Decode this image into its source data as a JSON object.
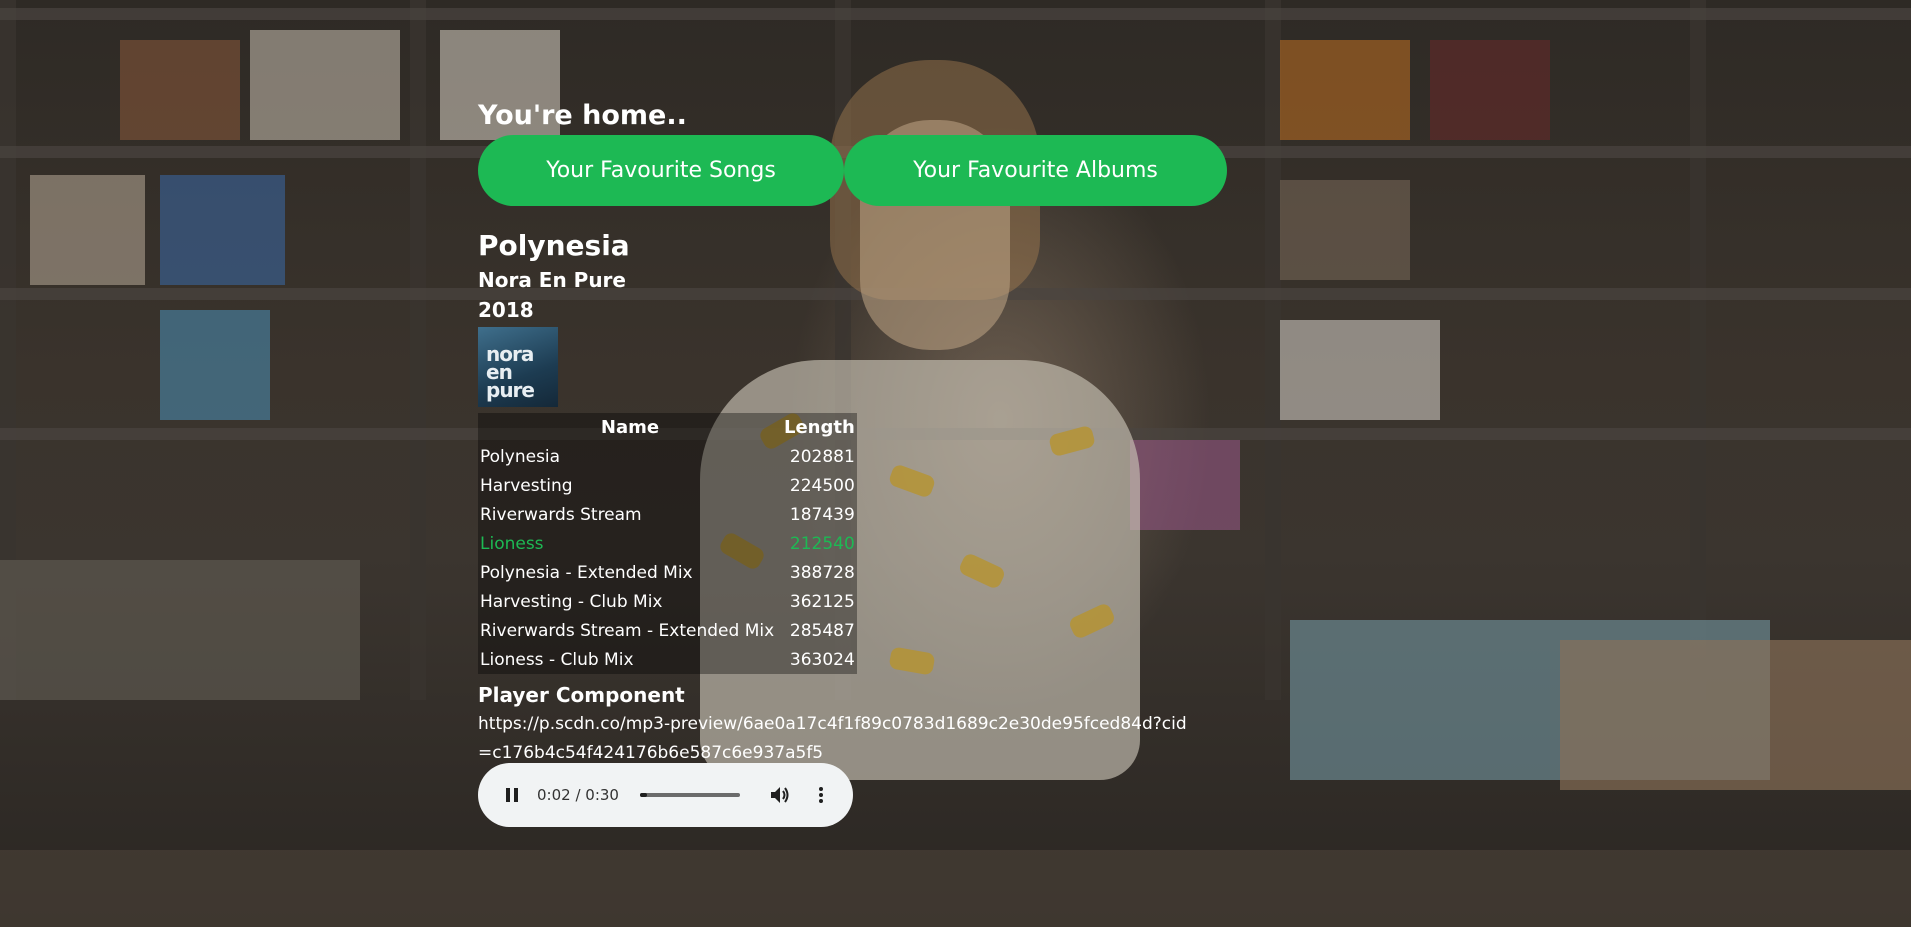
{
  "page": {
    "heading": "You're home.."
  },
  "nav": {
    "songs_label": "Your Favourite Songs",
    "albums_label": "Your Favourite Albums"
  },
  "album": {
    "title": "Polynesia",
    "artist": "Nora En Pure",
    "year": "2018",
    "cover_text": [
      "nora",
      "en",
      "pure"
    ]
  },
  "tracks": {
    "headers": [
      "Name",
      "Length"
    ],
    "rows": [
      {
        "name": "Polynesia",
        "length": "202881"
      },
      {
        "name": "Harvesting",
        "length": "224500"
      },
      {
        "name": "Riverwards Stream",
        "length": "187439"
      },
      {
        "name": "Lioness",
        "length": "212540",
        "active": true
      },
      {
        "name": "Polynesia - Extended Mix",
        "length": "388728"
      },
      {
        "name": "Harvesting - Club Mix",
        "length": "362125"
      },
      {
        "name": "Riverwards Stream - Extended Mix",
        "length": "285487"
      },
      {
        "name": "Lioness - Club Mix",
        "length": "363024"
      }
    ],
    "active_color": "#1db954"
  },
  "player": {
    "heading": "Player Component",
    "url": "https://p.scdn.co/mp3-preview/6ae0a17c4f1f89c0783d1689c2e30de95fced84d?cid=c176b4c54f424176b6e587c6e937a5f5",
    "time": "0:02 / 0:30",
    "progress": 0.067,
    "state": "playing",
    "icons": [
      "pause-icon",
      "volume-icon",
      "more-vertical-icon"
    ]
  },
  "colors": {
    "accent": "#1db954",
    "player_bg": "#f1f3f4",
    "text": "#ffffff"
  }
}
